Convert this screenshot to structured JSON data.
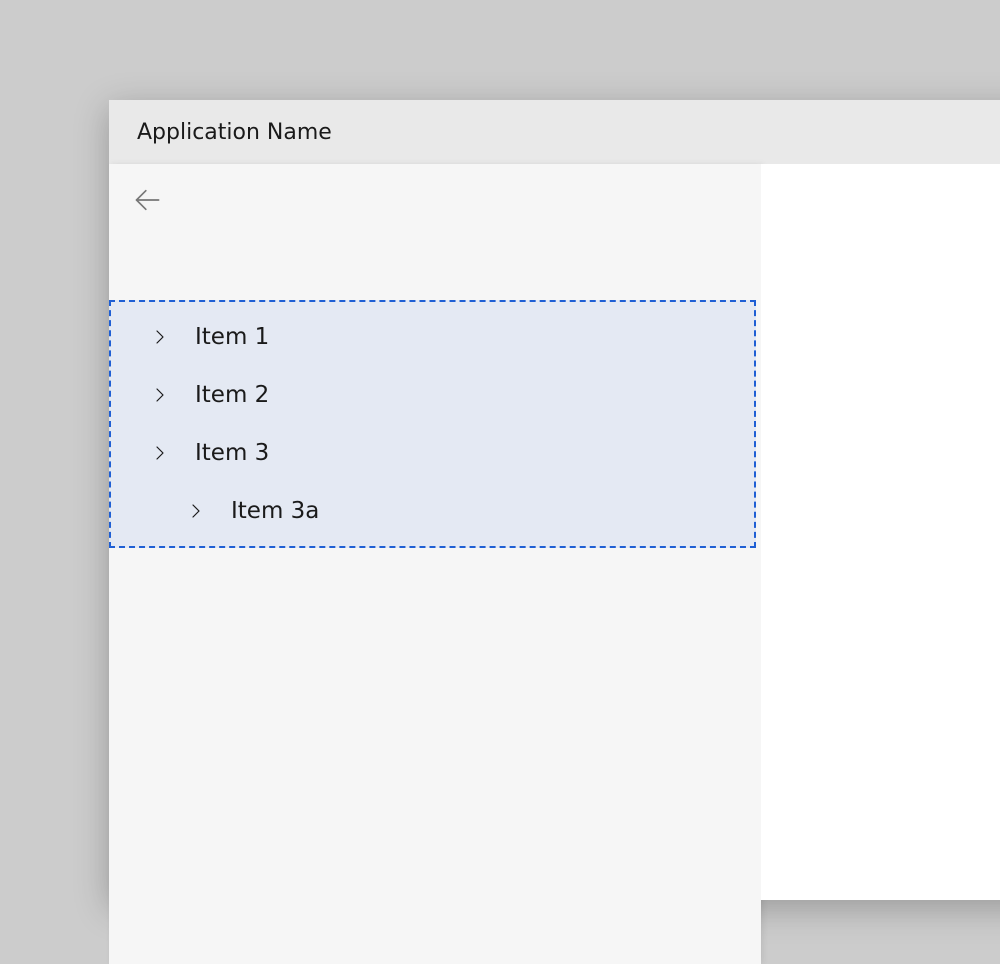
{
  "app": {
    "title": "Application Name"
  },
  "nav": {
    "back_icon": "back",
    "items": [
      {
        "label": "Item 1",
        "depth": 0
      },
      {
        "label": "Item 2",
        "depth": 0
      },
      {
        "label": "Item 3",
        "depth": 0
      },
      {
        "label": "Item 3a",
        "depth": 1
      }
    ]
  },
  "colors": {
    "highlight_border": "#1f5fd4",
    "highlight_fill": "rgba(31,95,212,0.08)"
  }
}
